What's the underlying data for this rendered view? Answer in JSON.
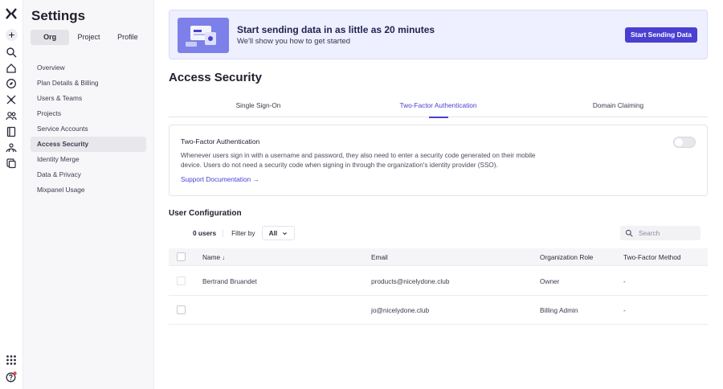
{
  "sidebar": {
    "title": "Settings",
    "tabs": [
      {
        "label": "Org",
        "active": true
      },
      {
        "label": "Project",
        "active": false
      },
      {
        "label": "Profile",
        "active": false
      }
    ],
    "items": [
      {
        "label": "Overview"
      },
      {
        "label": "Plan Details & Billing"
      },
      {
        "label": "Users & Teams"
      },
      {
        "label": "Projects"
      },
      {
        "label": "Service Accounts"
      },
      {
        "label": "Access Security",
        "active": true
      },
      {
        "label": "Identity Merge"
      },
      {
        "label": "Data & Privacy"
      },
      {
        "label": "Mixpanel Usage"
      }
    ]
  },
  "rail": {
    "icons": [
      "logo-icon",
      "plus-icon",
      "search-icon",
      "home-icon",
      "compass-icon",
      "sparkle-icon",
      "users-icon",
      "book-icon",
      "team-icon",
      "copy-icon",
      "apps-grid-icon",
      "help-notification-icon"
    ]
  },
  "banner": {
    "title": "Start sending data in as little as 20 minutes",
    "subtitle": "We'll show you how to get started",
    "button": "Start Sending Data"
  },
  "page": {
    "title": "Access Security",
    "tabs": [
      {
        "label": "Single Sign-On",
        "active": false
      },
      {
        "label": "Two-Factor Authentication",
        "active": true
      },
      {
        "label": "Domain Claiming",
        "active": false
      }
    ]
  },
  "twofa": {
    "title": "Two-Factor Authentication",
    "description": "Whenever users sign in with a username and password, they also need to enter a security code generated on their mobile device. Users do not need a security code when signing in through the organization's identity provider (SSO).",
    "link": "Support Documentation →",
    "enabled": false
  },
  "users": {
    "title": "User Configuration",
    "count": "0 users",
    "filter_label": "Filter by",
    "filter_value": "All",
    "search_placeholder": "Search",
    "columns": [
      "Name",
      "Email",
      "Organization Role",
      "Two-Factor Method"
    ],
    "sort_indicator": "↓",
    "rows": [
      {
        "name": "Bertrand Bruandet",
        "email": "products@nicelydone.club",
        "role": "Owner",
        "method": "-"
      },
      {
        "name": "",
        "email": "jo@nicelydone.club",
        "role": "Billing Admin",
        "method": "-"
      }
    ]
  },
  "colors": {
    "accent": "#4a3fd1",
    "banner_bg": "#eeefff"
  }
}
